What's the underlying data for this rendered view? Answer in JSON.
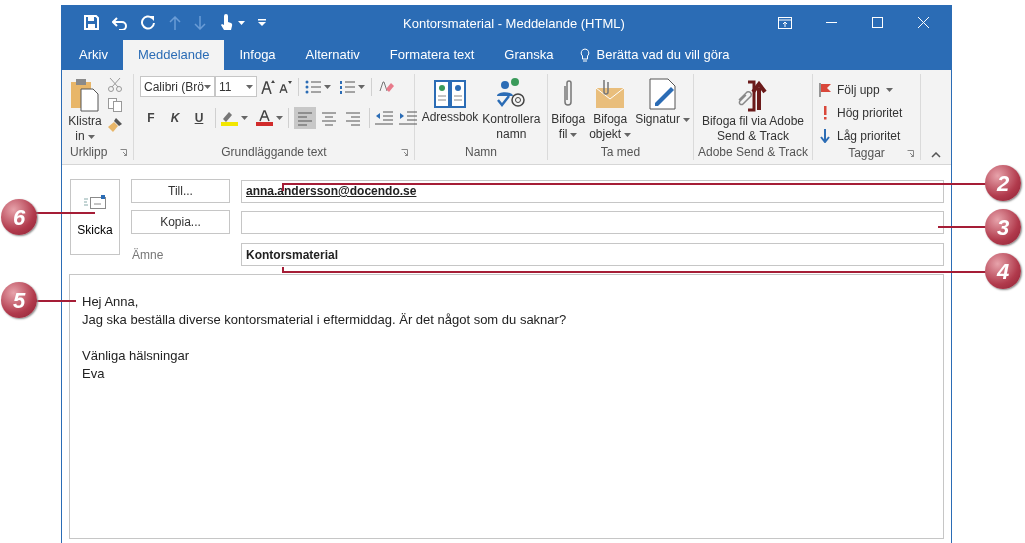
{
  "window": {
    "title": "Kontorsmaterial - Meddelande (HTML)"
  },
  "tabs": [
    {
      "label": "Arkiv",
      "selected": false
    },
    {
      "label": "Meddelande",
      "selected": true
    },
    {
      "label": "Infoga",
      "selected": false
    },
    {
      "label": "Alternativ",
      "selected": false
    },
    {
      "label": "Formatera text",
      "selected": false
    },
    {
      "label": "Granska",
      "selected": false
    }
  ],
  "tell_me": "Berätta vad du vill göra",
  "ribbon": {
    "groups": [
      {
        "kind": "clipboard",
        "label": "Urklipp",
        "paste": {
          "label_lines": [
            "Klistra",
            "in"
          ],
          "dropdown": true
        }
      },
      {
        "kind": "font",
        "label": "Grundläggande text",
        "font_name": "Calibri (Brö",
        "font_size": "11",
        "style_buttons": [
          "F",
          "K",
          "U"
        ],
        "alignment": [
          {
            "selected": true
          },
          {
            "selected": false
          },
          {
            "selected": false
          }
        ]
      },
      {
        "kind": "names",
        "label": "Namn",
        "buttons": [
          {
            "label_lines": [
              "Adressbok"
            ],
            "dropdown": false
          },
          {
            "label_lines": [
              "Kontrollera",
              "namn"
            ],
            "dropdown": false
          }
        ]
      },
      {
        "kind": "include",
        "label": "Ta med",
        "buttons": [
          {
            "label_lines": [
              "Bifoga",
              "fil"
            ],
            "dropdown": true
          },
          {
            "label_lines": [
              "Bifoga",
              "objekt"
            ],
            "dropdown": true
          },
          {
            "label_lines": [
              "Signatur"
            ],
            "dropdown": true
          }
        ]
      },
      {
        "kind": "adobe",
        "label": "Adobe Send & Track",
        "buttons": [
          {
            "label_lines": [
              "Bifoga fil via Adobe",
              "Send & Track"
            ],
            "dropdown": false
          }
        ]
      },
      {
        "kind": "tags",
        "label": "Taggar",
        "items": [
          {
            "label": "Följ upp",
            "dropdown": true
          },
          {
            "label": "Hög prioritet",
            "dropdown": false
          },
          {
            "label": "Låg prioritet",
            "dropdown": false
          }
        ]
      }
    ]
  },
  "compose": {
    "send": "Skicka",
    "to_button": "Till...",
    "to_value": "anna.andersson@docendo.se",
    "cc_button": "Kopia...",
    "subject_label": "Ämne",
    "subject_value": "Kontorsmaterial"
  },
  "body": [
    [
      "Hej Anna,",
      "Jag ska beställa diverse kontorsmaterial i eftermiddag. Är det något som du saknar?"
    ],
    [
      "Vänliga hälsningar",
      "Eva"
    ]
  ],
  "callouts": [
    {
      "label": "2"
    },
    {
      "label": "6"
    },
    {
      "label": "3"
    },
    {
      "label": "4"
    },
    {
      "label": "5"
    }
  ]
}
